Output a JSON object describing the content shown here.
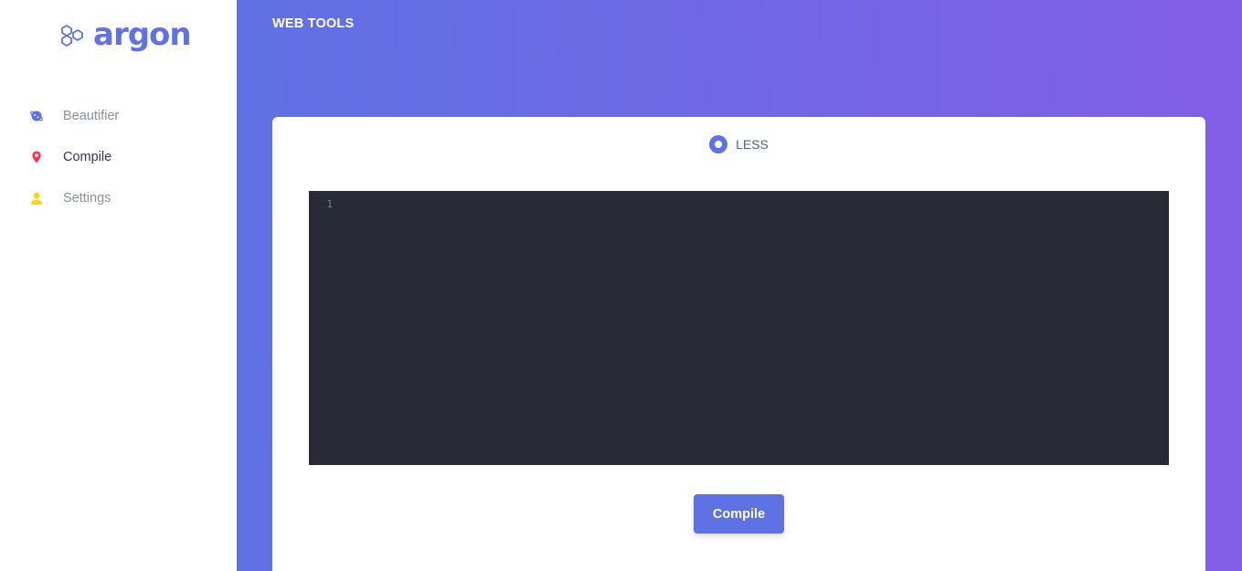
{
  "brand": {
    "name": "argon",
    "logo_icon": "hexagons-icon",
    "color": "#5e72e4"
  },
  "sidebar": {
    "items": [
      {
        "label": "Beautifier",
        "icon": "planet-icon",
        "icon_color": "#5e72e4",
        "active": false
      },
      {
        "label": "Compile",
        "icon": "map-pin-icon",
        "icon_color": "#f5365c",
        "active": true
      },
      {
        "label": "Settings",
        "icon": "user-icon",
        "icon_color": "#ffd600",
        "active": false
      }
    ]
  },
  "header": {
    "title": "WEB TOOLS"
  },
  "main": {
    "gradient_start": "#5e72e4",
    "gradient_end": "#825ee4",
    "language_option": {
      "label": "LESS",
      "selected": true
    },
    "editor": {
      "line_numbers": [
        "1"
      ],
      "background": "#282a36"
    },
    "compile_button": {
      "label": "Compile"
    }
  }
}
